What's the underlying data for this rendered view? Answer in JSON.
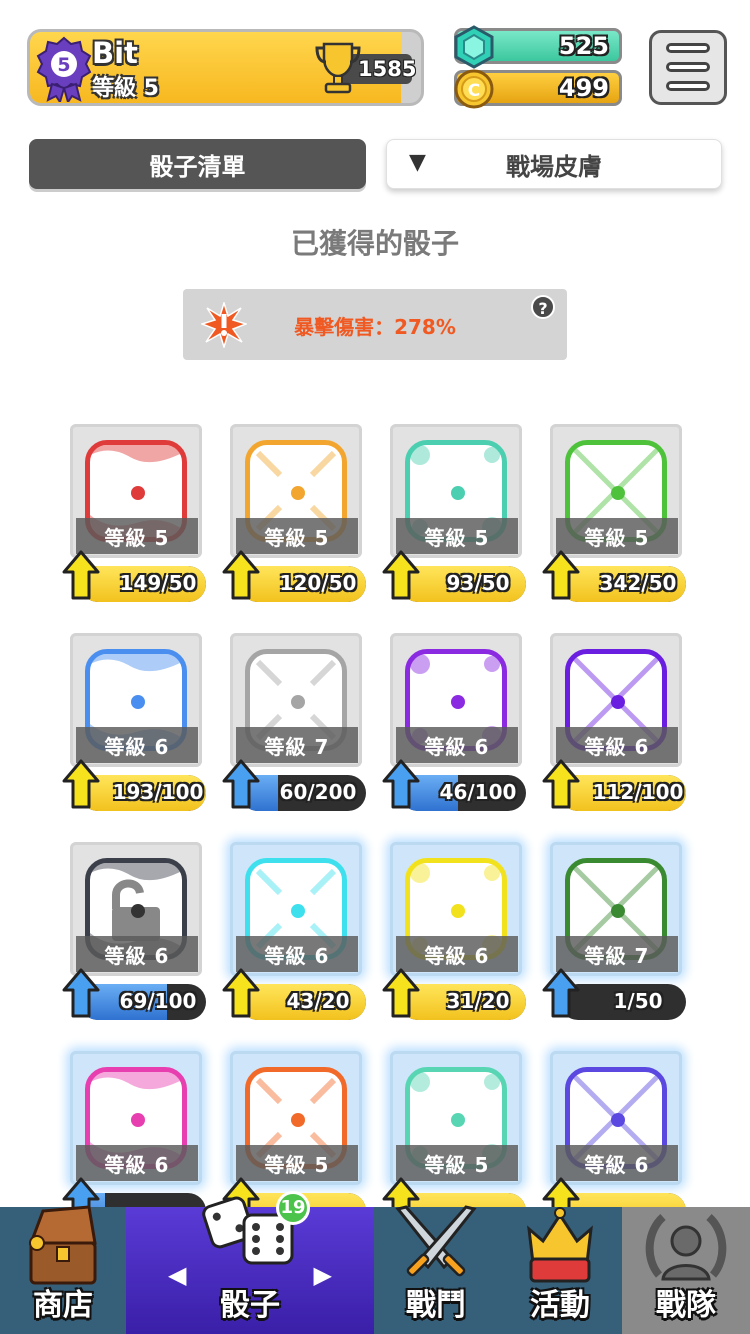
{
  "header": {
    "rank_number": "5",
    "player_name": "Bit",
    "player_level": "等級 5",
    "trophies": "1585",
    "gems": "525",
    "gold": "499",
    "gold_coin_letter": "C"
  },
  "tabs": {
    "dice_list": "骰子清單",
    "battlefield_skins": "戰場皮膚",
    "skins_arrow": "▼"
  },
  "section_title": "已獲得的骰子",
  "crit": {
    "text": "暴擊傷害：278%",
    "help": "?"
  },
  "dice": [
    {
      "level": "等級 5",
      "progress": "149/50",
      "fill": 1.0,
      "bar": "gold",
      "color": "#e03b3b",
      "glow": false
    },
    {
      "level": "等級 5",
      "progress": "120/50",
      "fill": 1.0,
      "bar": "gold",
      "color": "#f2a630",
      "glow": false
    },
    {
      "level": "等級 5",
      "progress": "93/50",
      "fill": 1.0,
      "bar": "gold",
      "color": "#4ccfb0",
      "glow": false
    },
    {
      "level": "等級 5",
      "progress": "342/50",
      "fill": 1.0,
      "bar": "gold",
      "color": "#4fc23c",
      "glow": false
    },
    {
      "level": "等級 6",
      "progress": "193/100",
      "fill": 1.0,
      "bar": "gold",
      "color": "#4a8ff0",
      "glow": false
    },
    {
      "level": "等級 7",
      "progress": "60/200",
      "fill": 0.3,
      "bar": "blue",
      "color": "#a5a5a5",
      "glow": false
    },
    {
      "level": "等級 6",
      "progress": "46/100",
      "fill": 0.46,
      "bar": "blue",
      "color": "#8a2be2",
      "glow": false
    },
    {
      "level": "等級 6",
      "progress": "112/100",
      "fill": 1.0,
      "bar": "gold",
      "color": "#6a1fe0",
      "glow": false
    },
    {
      "level": "等級 6",
      "progress": "69/100",
      "fill": 0.69,
      "bar": "blue",
      "color": "#3a3f4a",
      "glow": false,
      "lock": true
    },
    {
      "level": "等級 6",
      "progress": "43/20",
      "fill": 1.0,
      "bar": "gold",
      "color": "#3fe0ee",
      "glow": true
    },
    {
      "level": "等級 6",
      "progress": "31/20",
      "fill": 1.0,
      "bar": "gold",
      "color": "#f2e21e",
      "glow": true
    },
    {
      "level": "等級 7",
      "progress": "1/50",
      "fill": 0.02,
      "bar": "blue",
      "color": "#3a8a32",
      "glow": true
    },
    {
      "level": "等級 6",
      "progress": "",
      "fill": 0.2,
      "bar": "blue",
      "color": "#e83fb0",
      "glow": true
    },
    {
      "level": "等級 5",
      "progress": "",
      "fill": 1.0,
      "bar": "gold",
      "color": "#f26a2a",
      "glow": true
    },
    {
      "level": "等級 5",
      "progress": "",
      "fill": 1.0,
      "bar": "gold",
      "color": "#58d6b4",
      "glow": true
    },
    {
      "level": "等級 6",
      "progress": "",
      "fill": 1.0,
      "bar": "gold",
      "color": "#5a48e0",
      "glow": true
    }
  ],
  "nav": {
    "shop": "商店",
    "dice": "骰子",
    "dice_badge": "19",
    "battle": "戰鬥",
    "events": "活動",
    "clan": "戰隊",
    "left_arrow": "◀",
    "right_arrow": "▶"
  },
  "colors": {
    "accent_gold": "#f7b820",
    "gem_green": "#3cc79e",
    "crit_orange": "#f05a22",
    "nav_active": "#4a2cc4"
  }
}
